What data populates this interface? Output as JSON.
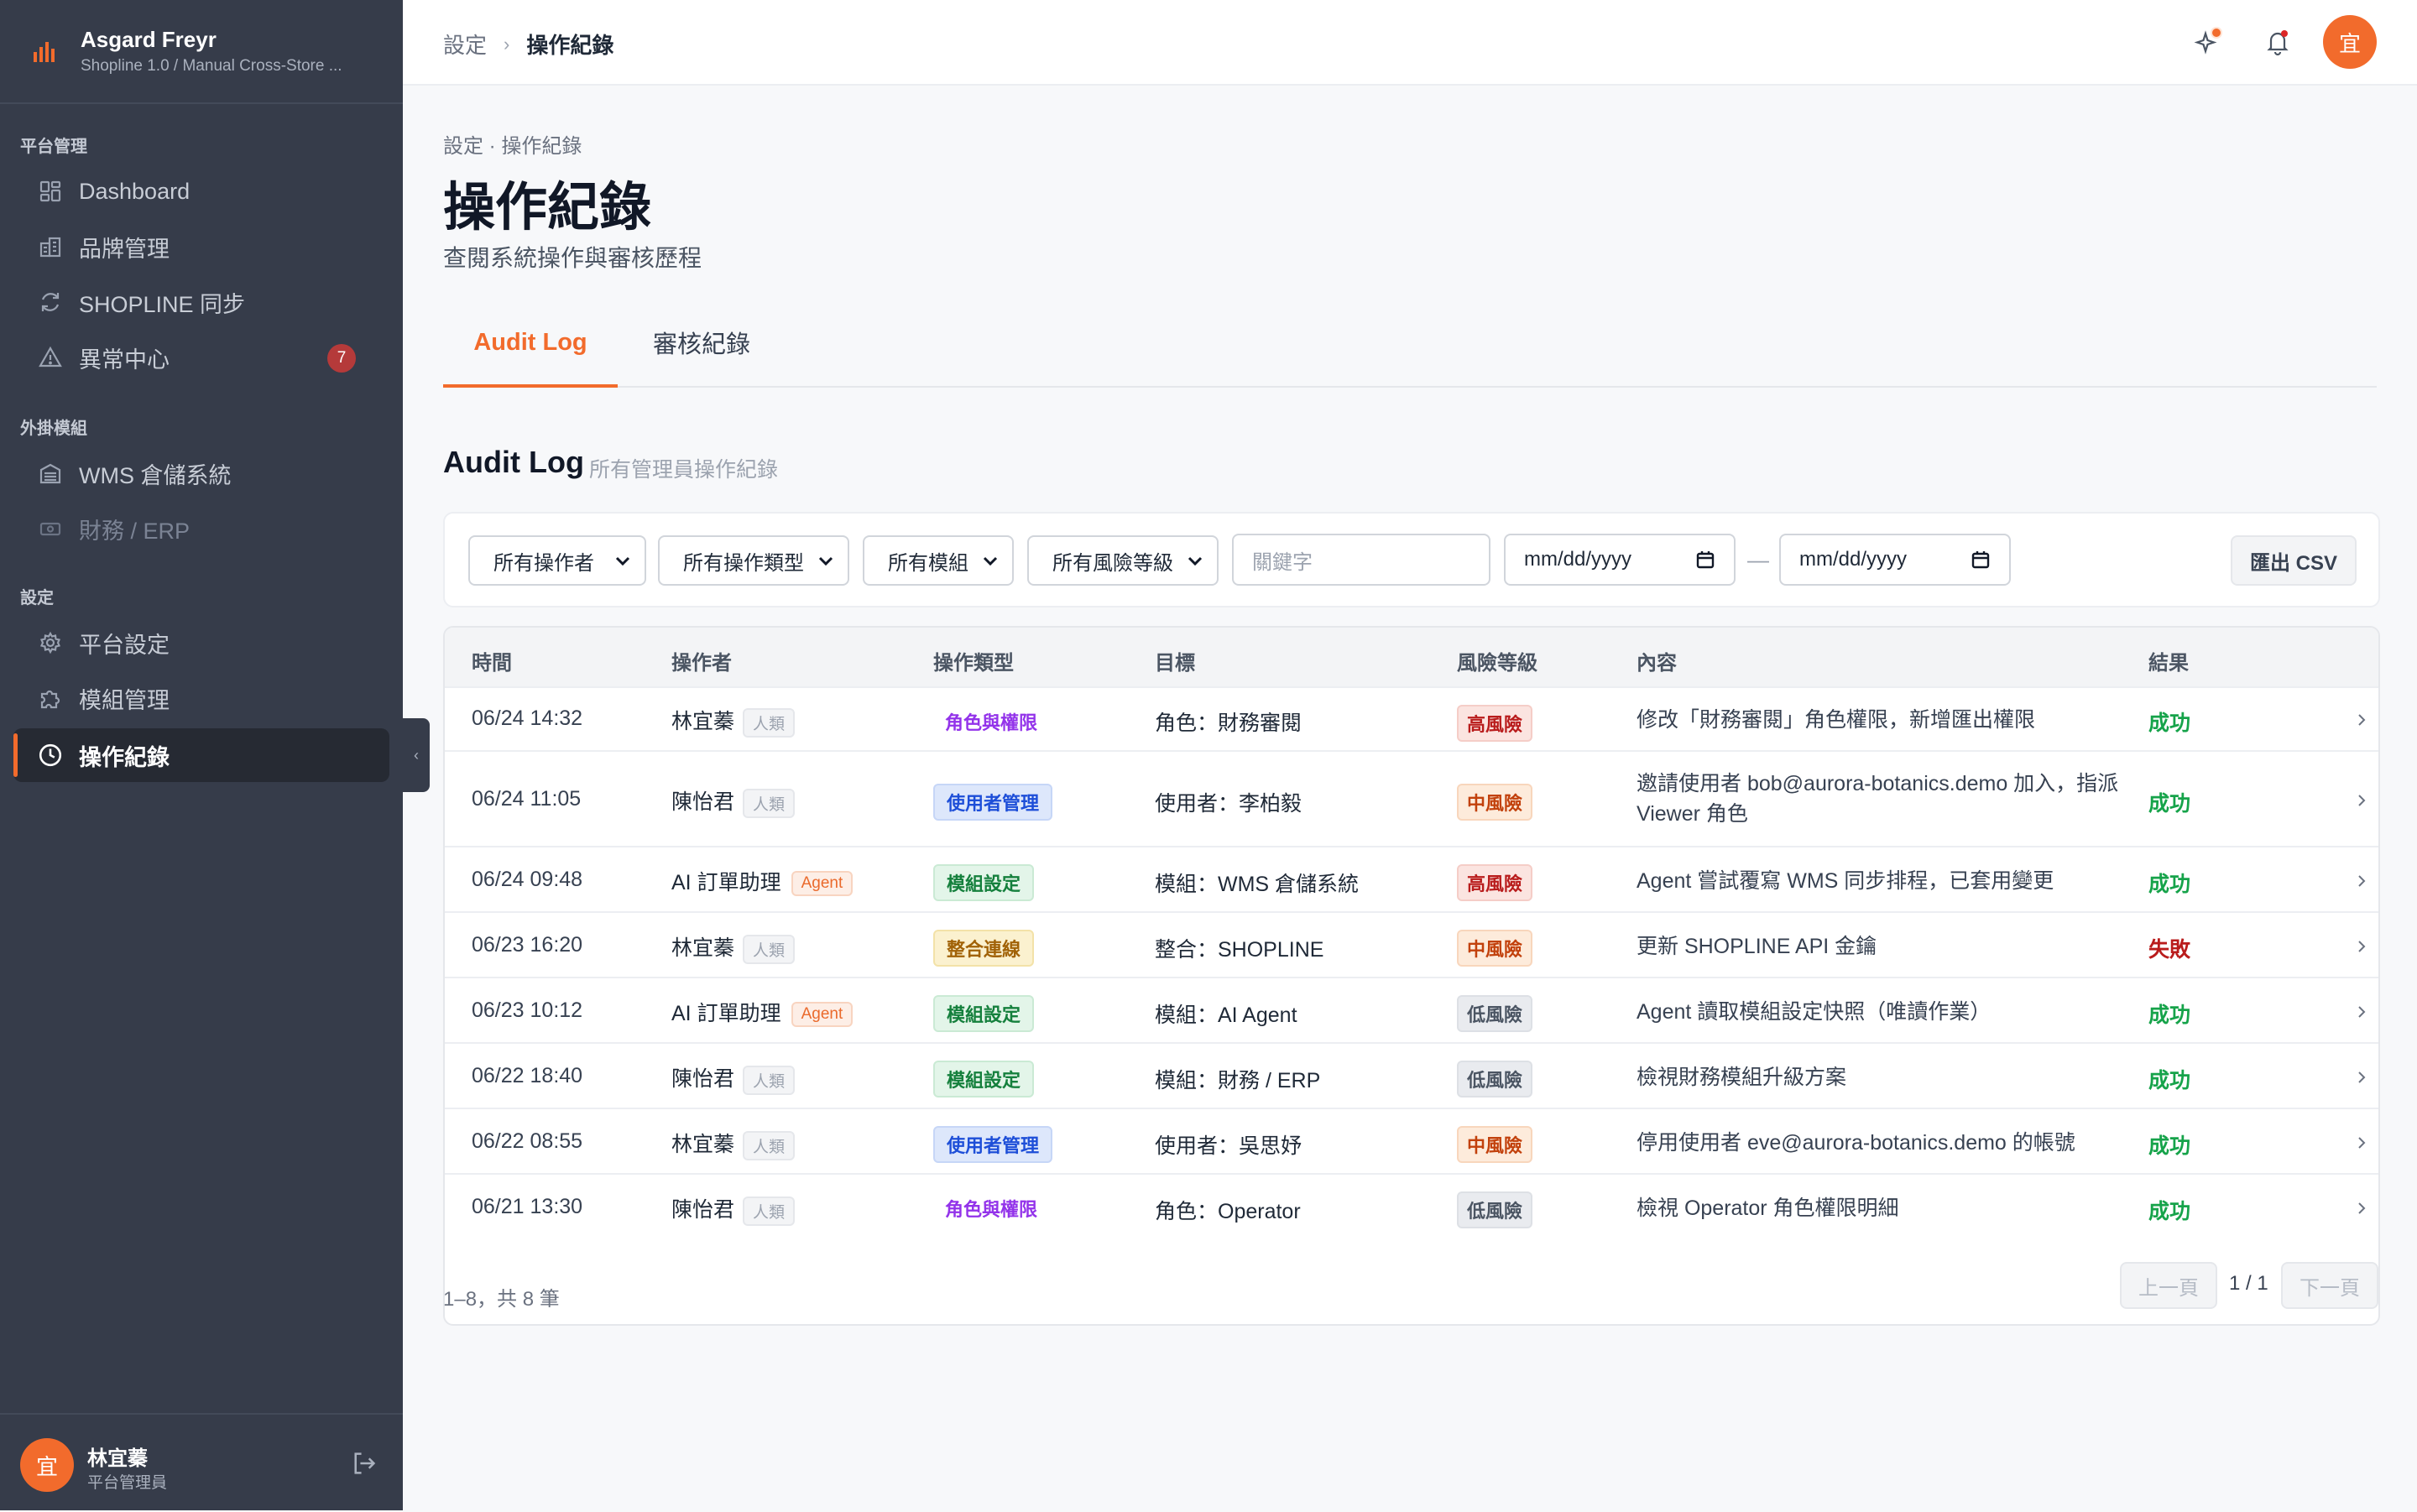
{
  "brand": {
    "name": "Asgard Freyr",
    "subtitle": "Shopline 1.0 / Manual Cross-Store ..."
  },
  "sidebar": {
    "sections": [
      {
        "label": "平台管理"
      },
      {
        "label": "外掛模組"
      },
      {
        "label": "設定"
      }
    ],
    "items": [
      {
        "label": "Dashboard",
        "icon": "dashboard-icon"
      },
      {
        "label": "品牌管理",
        "icon": "building-icon"
      },
      {
        "label": "SHOPLINE 同步",
        "icon": "sync-icon"
      },
      {
        "label": "異常中心",
        "icon": "warning-icon",
        "badge": "7"
      },
      {
        "label": "WMS 倉儲系統",
        "icon": "warehouse-icon"
      },
      {
        "label": "財務 / ERP",
        "icon": "finance-icon",
        "disabled": true
      },
      {
        "label": "平台設定",
        "icon": "gear-icon"
      },
      {
        "label": "模組管理",
        "icon": "puzzle-icon"
      },
      {
        "label": "操作紀錄",
        "icon": "clock-icon",
        "active": true
      }
    ],
    "user": {
      "avatar": "宜",
      "name": "林宜蓁",
      "role": "平台管理員"
    }
  },
  "topbar": {
    "breadcrumb": [
      "設定",
      "操作紀錄"
    ],
    "avatar": "宜"
  },
  "page": {
    "sub_crumb": "設定 · 操作紀錄",
    "title": "操作紀錄",
    "description": "查閱系統操作與審核歷程",
    "tabs": [
      "Audit Log",
      "審核紀錄"
    ],
    "section_title": "Audit Log",
    "section_sub": "所有管理員操作紀錄"
  },
  "filters": {
    "operator": "所有操作者",
    "op_type": "所有操作類型",
    "module": "所有模組",
    "risk": "所有風險等級",
    "keyword_placeholder": "關鍵字",
    "date_from": "mm/dd/yyyy",
    "date_to": "mm/dd/yyyy",
    "date_sep": "—",
    "export_label": "匯出 CSV"
  },
  "table": {
    "headers": [
      "時間",
      "操作者",
      "操作類型",
      "目標",
      "風險等級",
      "內容",
      "結果"
    ],
    "rows": [
      {
        "time": "06/24 14:32",
        "operator": "林宜蓁",
        "op_tag": "人類",
        "op_type": "角色與權限",
        "target": "角色：財務審閱",
        "risk": "高風險",
        "content": "修改「財務審閱」角色權限，新增匯出權限",
        "result": "成功"
      },
      {
        "time": "06/24 11:05",
        "operator": "陳怡君",
        "op_tag": "人類",
        "op_type": "使用者管理",
        "target": "使用者：李柏毅",
        "risk": "中風險",
        "content": "邀請使用者 bob@aurora-botanics.demo 加入，指派 Viewer 角色",
        "result": "成功"
      },
      {
        "time": "06/24 09:48",
        "operator": "AI 訂單助理",
        "op_tag": "Agent",
        "op_type": "模組設定",
        "target": "模組：WMS 倉儲系統",
        "risk": "高風險",
        "content": "Agent 嘗試覆寫 WMS 同步排程，已套用變更",
        "result": "成功"
      },
      {
        "time": "06/23 16:20",
        "operator": "林宜蓁",
        "op_tag": "人類",
        "op_type": "整合連線",
        "target": "整合：SHOPLINE",
        "risk": "中風險",
        "content": "更新 SHOPLINE API 金鑰",
        "result": "失敗"
      },
      {
        "time": "06/23 10:12",
        "operator": "AI 訂單助理",
        "op_tag": "Agent",
        "op_type": "模組設定",
        "target": "模組：AI Agent",
        "risk": "低風險",
        "content": "Agent 讀取模組設定快照（唯讀作業）",
        "result": "成功"
      },
      {
        "time": "06/22 18:40",
        "operator": "陳怡君",
        "op_tag": "人類",
        "op_type": "模組設定",
        "target": "模組：財務 / ERP",
        "risk": "低風險",
        "content": "檢視財務模組升級方案",
        "result": "成功"
      },
      {
        "time": "06/22 08:55",
        "operator": "林宜蓁",
        "op_tag": "人類",
        "op_type": "使用者管理",
        "target": "使用者：吳思妤",
        "risk": "中風險",
        "content": "停用使用者 eve@aurora-botanics.demo 的帳號",
        "result": "成功"
      },
      {
        "time": "06/21 13:30",
        "operator": "陳怡君",
        "op_tag": "人類",
        "op_type": "角色與權限",
        "target": "角色：Operator",
        "risk": "低風險",
        "content": "檢視 Operator 角色權限明細",
        "result": "成功"
      }
    ]
  },
  "pagination": {
    "summary": "1–8，共 8 筆",
    "prev": "上一頁",
    "page": "1 / 1",
    "next": "下一頁"
  },
  "colors": {
    "accent": "#f26b2c",
    "sidebar_bg": "#363c4a",
    "success": "#16a34a",
    "danger": "#b91c1c"
  }
}
